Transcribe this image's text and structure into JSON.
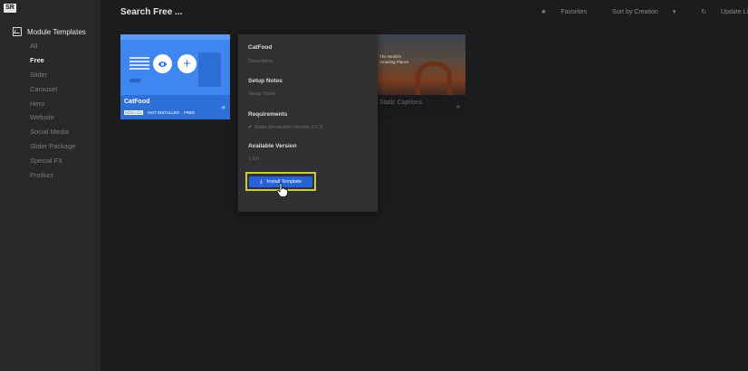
{
  "app": {
    "logo": "SR"
  },
  "sidebar": {
    "heading": "Module Templates",
    "items": [
      {
        "label": "All"
      },
      {
        "label": "Free"
      },
      {
        "label": "Slider"
      },
      {
        "label": "Carousel"
      },
      {
        "label": "Hero"
      },
      {
        "label": "Website"
      },
      {
        "label": "Social Media"
      },
      {
        "label": "Slider Package"
      },
      {
        "label": "Special FX"
      },
      {
        "label": "Product"
      }
    ],
    "active": "Free"
  },
  "header": {
    "search": "Search Free ...",
    "favorites": "Favorites",
    "sort": "Sort by Creation",
    "update": "Update Li"
  },
  "cards": [
    {
      "title": "CatFood",
      "tags": [
        "MODULE",
        "NOT INSTALLED",
        "FREE"
      ]
    },
    {
      "title": "Static Captions",
      "sub": "",
      "thumb_line1": "The World's",
      "thumb_line2": "Amazing Places"
    }
  ],
  "popup": {
    "title": "CatFood",
    "description": "Description",
    "setup_label": "Setup Notes",
    "setup_value": "Setup Notes",
    "requirements_label": "Requirements",
    "requirement": "Slider Revolution Version 5.0.3",
    "version_label": "Available Version",
    "version_value": "1.0.0",
    "install_button": "Install Template"
  },
  "colors": {
    "accent": "#2563d6",
    "highlight": "#cbcb3a",
    "card_blue": "#3f86f0"
  }
}
